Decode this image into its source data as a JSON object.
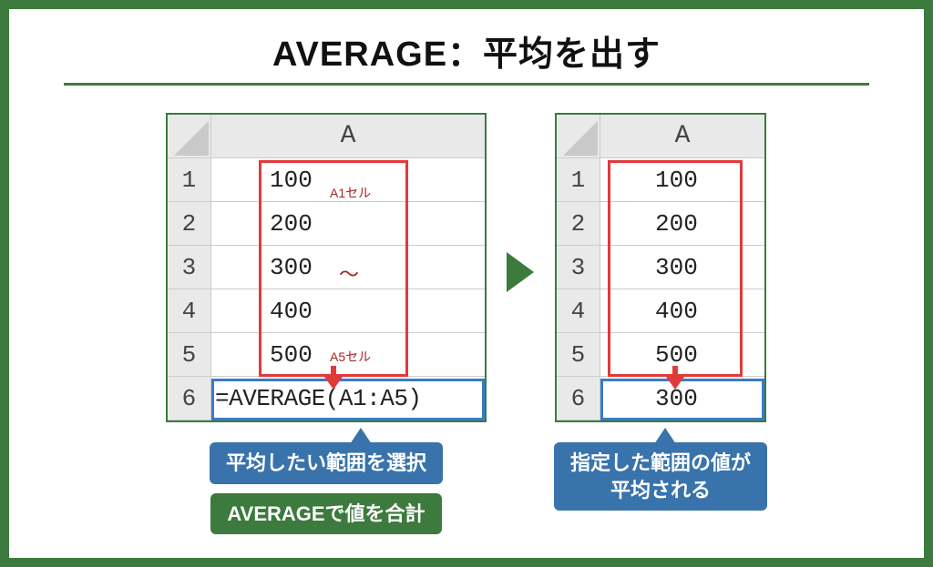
{
  "title": "AVERAGE：平均を出す",
  "column_label": "A",
  "row_labels": [
    "1",
    "2",
    "3",
    "4",
    "5",
    "6"
  ],
  "left_table": {
    "values": [
      "100",
      "200",
      "300",
      "400",
      "500"
    ],
    "formula": "=AVERAGE(A1:A5)",
    "anno_a1": "A1セル",
    "anno_tilde": "〜",
    "anno_a5": "A5セル"
  },
  "right_table": {
    "values": [
      "100",
      "200",
      "300",
      "400",
      "500"
    ],
    "result": "300"
  },
  "callout_left_blue": "平均したい範囲を選択",
  "callout_left_green": "AVERAGEで値を合計",
  "callout_right_blue": "指定した範囲の値が\n平均される"
}
